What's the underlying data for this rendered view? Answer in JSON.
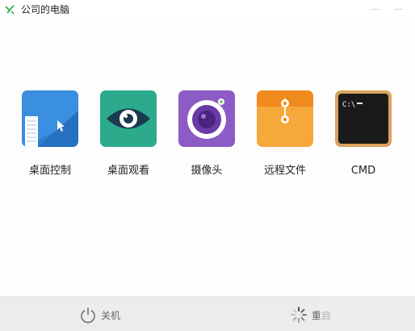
{
  "window": {
    "title": "公司的电脑"
  },
  "tiles": [
    {
      "label": "桌面控制",
      "icon": "remote-desktop-icon"
    },
    {
      "label": "桌面观看",
      "icon": "eye-icon"
    },
    {
      "label": "摄像头",
      "icon": "camera-icon"
    },
    {
      "label": "远程文件",
      "icon": "folder-icon"
    },
    {
      "label": "CMD",
      "icon": "terminal-icon"
    }
  ],
  "terminal_prompt": "C:\\",
  "bottombar": {
    "shutdown_label": "关机",
    "restart_label": "重启"
  },
  "colors": {
    "desktop_blue": "#2f7fd1",
    "eye_green": "#2bab8c",
    "camera_purple": "#8c5bc6",
    "folder_orange": "#f59a2d",
    "terminal_frame": "#d9a45c",
    "bottom_bar": "#ececec"
  }
}
